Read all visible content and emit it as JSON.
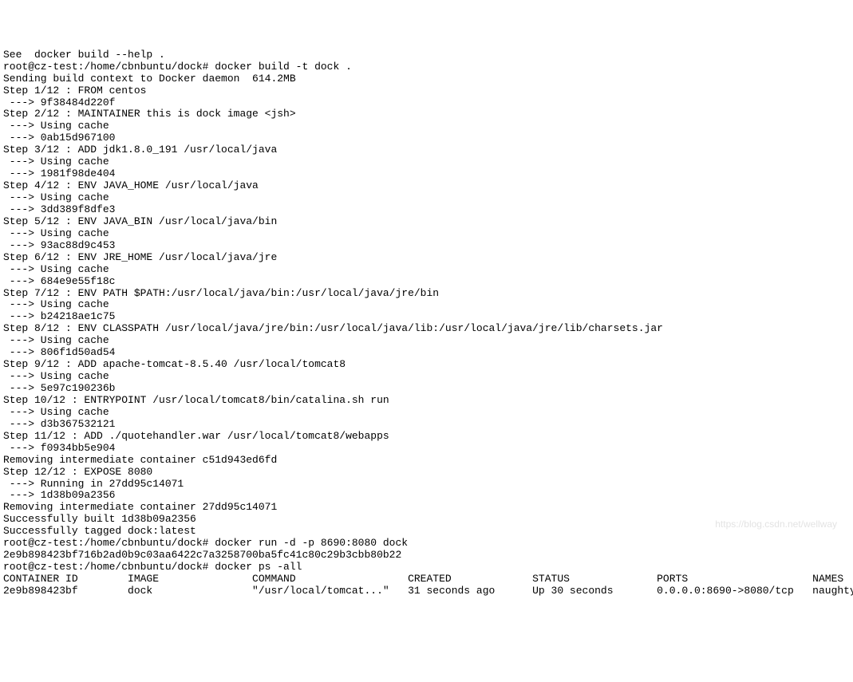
{
  "terminal": {
    "lines": [
      "See  docker build --help .",
      "root@cz-test:/home/cbnbuntu/dock# docker build -t dock .",
      "Sending build context to Docker daemon  614.2MB",
      "Step 1/12 : FROM centos",
      " ---> 9f38484d220f",
      "Step 2/12 : MAINTAINER this is dock image <jsh>",
      " ---> Using cache",
      " ---> 0ab15d967100",
      "Step 3/12 : ADD jdk1.8.0_191 /usr/local/java",
      " ---> Using cache",
      " ---> 1981f98de404",
      "Step 4/12 : ENV JAVA_HOME /usr/local/java",
      " ---> Using cache",
      " ---> 3dd389f8dfe3",
      "Step 5/12 : ENV JAVA_BIN /usr/local/java/bin",
      " ---> Using cache",
      " ---> 93ac88d9c453",
      "Step 6/12 : ENV JRE_HOME /usr/local/java/jre",
      " ---> Using cache",
      " ---> 684e9e55f18c",
      "Step 7/12 : ENV PATH $PATH:/usr/local/java/bin:/usr/local/java/jre/bin",
      " ---> Using cache",
      " ---> b24218ae1c75",
      "Step 8/12 : ENV CLASSPATH /usr/local/java/jre/bin:/usr/local/java/lib:/usr/local/java/jre/lib/charsets.jar",
      " ---> Using cache",
      " ---> 806f1d50ad54",
      "Step 9/12 : ADD apache-tomcat-8.5.40 /usr/local/tomcat8",
      " ---> Using cache",
      " ---> 5e97c190236b",
      "Step 10/12 : ENTRYPOINT /usr/local/tomcat8/bin/catalina.sh run",
      " ---> Using cache",
      " ---> d3b367532121",
      "Step 11/12 : ADD ./quotehandler.war /usr/local/tomcat8/webapps",
      " ---> f0934bb5e904",
      "Removing intermediate container c51d943ed6fd",
      "Step 12/12 : EXPOSE 8080",
      " ---> Running in 27dd95c14071",
      " ---> 1d38b09a2356",
      "Removing intermediate container 27dd95c14071",
      "Successfully built 1d38b09a2356",
      "Successfully tagged dock:latest",
      "root@cz-test:/home/cbnbuntu/dock# docker run -d -p 8690:8080 dock",
      "2e9b898423bf716b2ad0b9c03aa6422c7a3258700ba5fc41c80c29b3cbb80b22",
      "root@cz-test:/home/cbnbuntu/dock# docker ps -all",
      "CONTAINER ID        IMAGE               COMMAND                  CREATED             STATUS              PORTS                    NAMES",
      "2e9b898423bf        dock                \"/usr/local/tomcat...\"   31 seconds ago      Up 30 seconds       0.0.0.0:8690->8080/tcp   naughty_curie"
    ]
  },
  "watermark": "https://blog.csdn.net/wellway"
}
